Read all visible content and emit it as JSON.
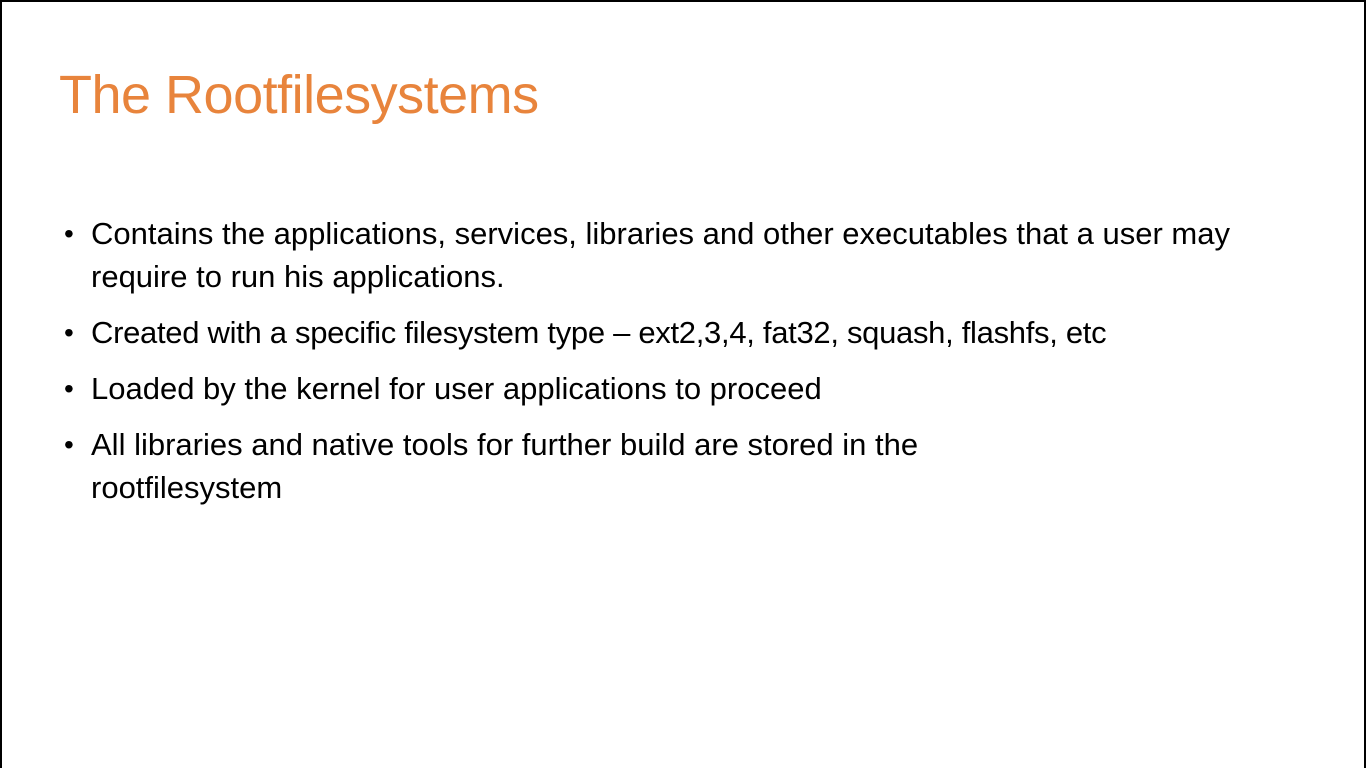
{
  "slide": {
    "title": "The Rootfilesystems",
    "title_color": "#E8843C",
    "text_color": "#000000",
    "bullet_glyph": "•",
    "bullets": [
      "Contains the applications, services, libraries and other executables that a user may require to run his applications.",
      "Created with a specific filesystem type – ext2,3,4, fat32, squash, flashfs, etc",
      "Loaded by the kernel for user applications to proceed",
      "All libraries and native tools for further build are stored in the rootfilesystem"
    ]
  }
}
